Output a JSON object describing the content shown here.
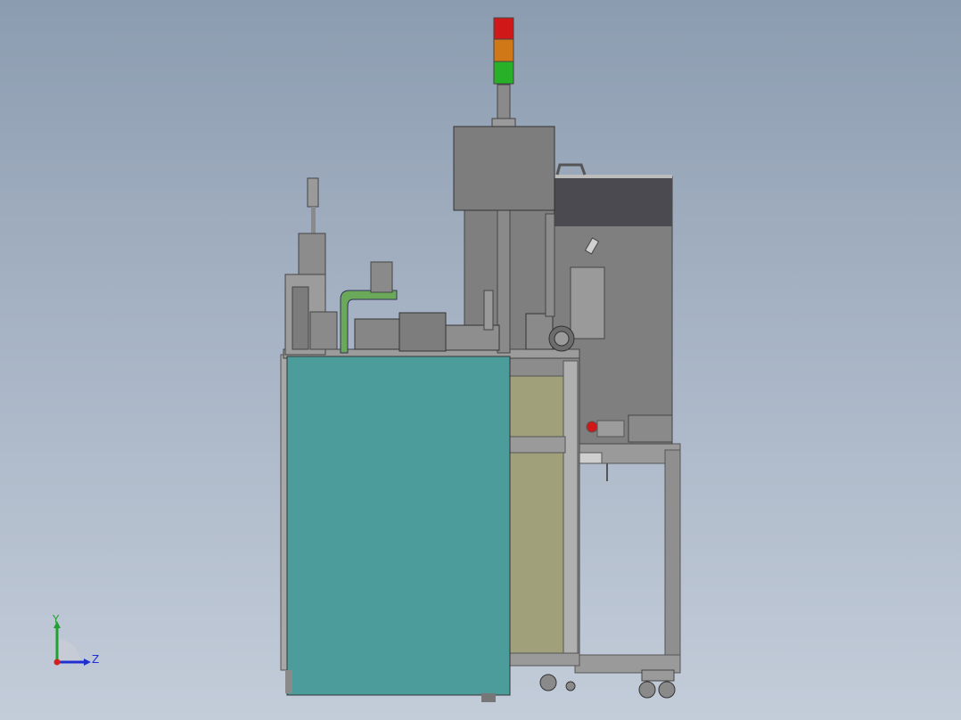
{
  "view": {
    "background_top": "#8c9cb0",
    "background_bottom": "#c3ccd9"
  },
  "triad": {
    "y_label": "Y",
    "z_label": "Z",
    "x_color": "#d22020",
    "y_color": "#20a030",
    "z_color": "#2030d0"
  },
  "model_colors": {
    "steel": "#7d7d7d",
    "frame": "#9a9a9a",
    "panel_teal": "#4c9c9c",
    "panel_olive": "#a0a07a",
    "dark_band": "#4a4a50",
    "accent_green": "#6aa85a",
    "lamp_red": "#d01818",
    "lamp_amber": "#d07818",
    "lamp_green": "#28b028"
  }
}
